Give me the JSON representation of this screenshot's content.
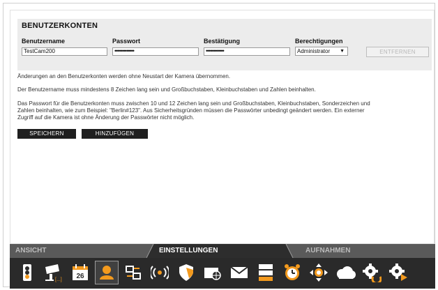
{
  "title": "BENUTZERKONTEN",
  "columns": {
    "username": "Benutzername",
    "password": "Passwort",
    "confirm": "Bestätigung",
    "permissions": "Berechtigungen"
  },
  "user_row": {
    "username": "TestCam200",
    "password": "•••••••••••••",
    "confirm": "••••••••••••",
    "permission": "Administrator"
  },
  "buttons": {
    "remove": "ENTFERNEN",
    "save": "SPEICHERN",
    "add": "HINZUFÜGEN"
  },
  "info": {
    "p1": "Änderungen an den Benutzerkonten werden ohne Neustart der Kamera übernommen.",
    "p2": "Der Benutzername muss mindestens 8 Zeichen lang sein und Großbuchstaben, Kleinbuchstaben und Zahlen beinhalten.",
    "p3_line1": "Das Passwort für die Benutzerkonten muss zwischen 10 und 12 Zeichen lang sein und Großbuchstaben, Kleinbuchstaben, Sonderzeichen und",
    "p3_line2": "Zahlen beinhalten, wie zum Beispiel: \"Berlin#123\". Aus Sicherheitsgründen müssen die Passwörter unbedingt geändert werden. Ein externer",
    "p3_line3": "Zugriff auf die Kamera ist ohne Änderung der Passwörter nicht möglich."
  },
  "tabs": [
    "ANSICHT",
    "EINSTELLUNGEN",
    "AUFNAHMEN"
  ],
  "calendar_day": "26",
  "icons": [
    "traffic-light-icon",
    "camera-icon",
    "calendar-icon",
    "user-icon",
    "network-icon",
    "wireless-icon",
    "shield-icon",
    "globe-window-icon",
    "mail-icon",
    "storage-icon",
    "alarm-clock-icon",
    "move-icon",
    "cloud-icon",
    "settings-refresh-icon",
    "settings-play-icon"
  ],
  "colors": {
    "panel_bg": "#ececec",
    "dark_button": "#1f1f1f",
    "tabbar": "#5a5a5a",
    "iconbar": "#2a2a2a",
    "accent_orange": "#f39a1e"
  }
}
